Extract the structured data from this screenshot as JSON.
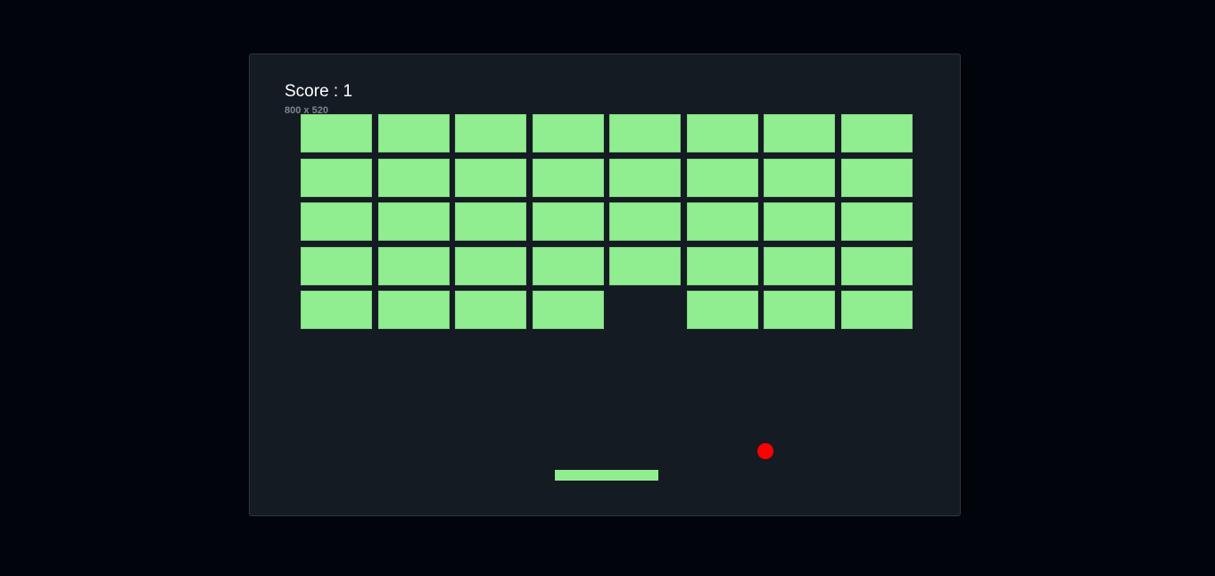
{
  "hud": {
    "score_text": "Score : 1",
    "canvas_size_text": "800 x 520"
  },
  "colors": {
    "page_background": "#01040a",
    "board_background": "#151b23",
    "brick": "#90ee90",
    "paddle": "#90ee90",
    "ball": "#ff0000"
  },
  "bricks": {
    "rows": 5,
    "columns": 8,
    "destroyed": [
      [
        4,
        4
      ]
    ]
  }
}
